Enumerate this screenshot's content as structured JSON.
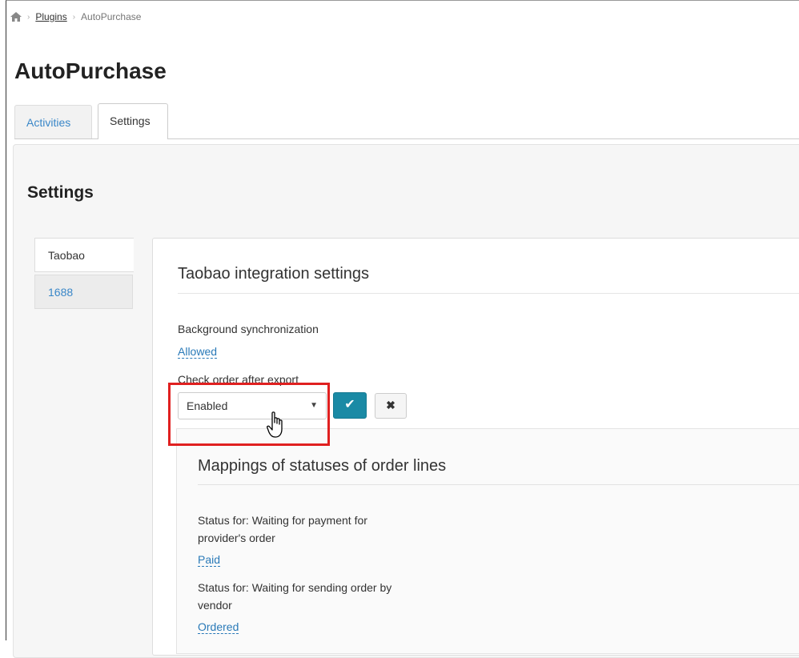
{
  "breadcrumb": {
    "home_icon": "home-icon",
    "plugins": "Plugins",
    "current": "AutoPurchase"
  },
  "page_title": "AutoPurchase",
  "tabs": [
    {
      "label": "Activities"
    },
    {
      "label": "Settings"
    }
  ],
  "settings": {
    "heading": "Settings",
    "side_tabs": [
      {
        "label": "Taobao"
      },
      {
        "label": "1688"
      }
    ],
    "section_title": "Taobao integration settings",
    "background_sync": {
      "label": "Background synchronization",
      "value": "Allowed"
    },
    "check_order": {
      "label": "Check order after export",
      "selected": "Enabled"
    },
    "mappings": {
      "title": "Mappings of statuses of order lines",
      "items": [
        {
          "label_line1": "Status for: Waiting for payment for",
          "label_line2": "provider's order",
          "value": "Paid"
        },
        {
          "label_line1": "Status for: Waiting for sending order by",
          "label_line2": "vendor",
          "value": "Ordered"
        }
      ]
    }
  },
  "colors": {
    "link": "#2a7ab8",
    "ok_button": "#1a8aa5",
    "highlight": "#e02020"
  }
}
